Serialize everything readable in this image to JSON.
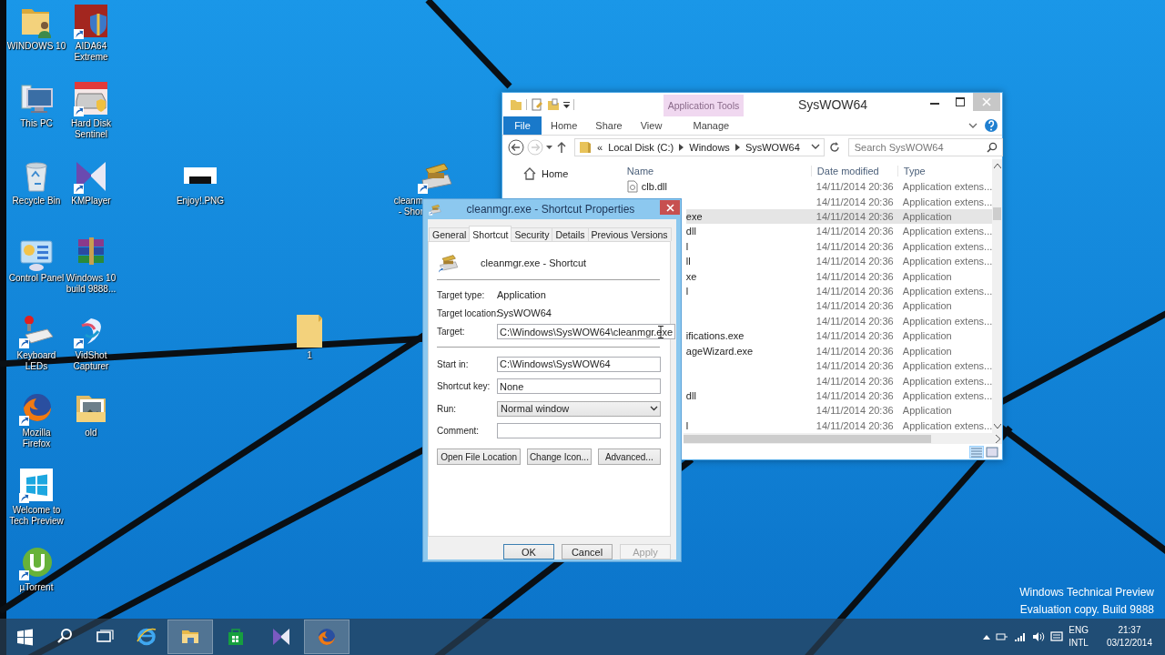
{
  "desktop": {
    "icons": [
      {
        "label": "WINDOWS 10"
      },
      {
        "label": "This PC"
      },
      {
        "label": "Recycle Bin"
      },
      {
        "label": "Control Panel"
      },
      {
        "label": "Keyboard\nLEDs"
      },
      {
        "label": "Mozilla\nFirefox"
      },
      {
        "label": "Welcome to\nTech Preview"
      },
      {
        "label": "µTorrent"
      },
      {
        "label": "AIDA64\nExtreme"
      },
      {
        "label": "Hard Disk\nSentinel"
      },
      {
        "label": "KMPlayer"
      },
      {
        "label": "Windows 10\nbuild 9888..."
      },
      {
        "label": "VidShot\nCapturer"
      },
      {
        "label": "old"
      },
      {
        "label": "Enjoy!.PNG"
      },
      {
        "label": "1"
      },
      {
        "label": "cleanm\n- Shor"
      }
    ],
    "edition": [
      "Windows Technical Preview",
      "Evaluation copy. Build 9888"
    ]
  },
  "explorer": {
    "title": "SysWOW64",
    "context_header": "Application Tools",
    "ribbon_tabs": [
      {
        "label": "File",
        "kind": "file"
      },
      {
        "label": "Home",
        "kind": "tab"
      },
      {
        "label": "Share",
        "kind": "tab"
      },
      {
        "label": "View",
        "kind": "tab"
      },
      {
        "label": "Manage",
        "kind": "context"
      }
    ],
    "address": {
      "overflow": "«",
      "crumbs": [
        "Local Disk (C:)",
        "Windows",
        "SysWOW64"
      ]
    },
    "search": {
      "placeholder": "Search SysWOW64"
    },
    "nav": [
      {
        "label": "Home"
      }
    ],
    "columns": [
      "Name",
      "Date modified",
      "Type"
    ],
    "rows": [
      {
        "name": "clb.dll",
        "date": "14/11/2014 20:36",
        "type": "Application extens...",
        "selected": false
      },
      {
        "date": "14/11/2014 20:36",
        "type": "Application extens...",
        "selected": false
      },
      {
        "name": "exe",
        "date": "14/11/2014 20:36",
        "type": "Application",
        "selected": true
      },
      {
        "name": "dll",
        "date": "14/11/2014 20:36",
        "type": "Application extens...",
        "selected": false
      },
      {
        "name": "l",
        "date": "14/11/2014 20:36",
        "type": "Application extens...",
        "selected": false
      },
      {
        "name": "ll",
        "date": "14/11/2014 20:36",
        "type": "Application extens...",
        "selected": false
      },
      {
        "name": "xe",
        "date": "14/11/2014 20:36",
        "type": "Application",
        "selected": false
      },
      {
        "name": "l",
        "date": "14/11/2014 20:36",
        "type": "Application extens...",
        "selected": false
      },
      {
        "date": "14/11/2014 20:36",
        "type": "Application",
        "selected": false
      },
      {
        "date": "14/11/2014 20:36",
        "type": "Application extens...",
        "selected": false
      },
      {
        "name": "ifications.exe",
        "date": "14/11/2014 20:36",
        "type": "Application",
        "selected": false
      },
      {
        "name": "ageWizard.exe",
        "date": "14/11/2014 20:36",
        "type": "Application",
        "selected": false
      },
      {
        "date": "14/11/2014 20:36",
        "type": "Application extens...",
        "selected": false
      },
      {
        "date": "14/11/2014 20:36",
        "type": "Application extens...",
        "selected": false
      },
      {
        "name": "dll",
        "date": "14/11/2014 20:36",
        "type": "Application extens...",
        "selected": false
      },
      {
        "date": "14/11/2014 20:36",
        "type": "Application",
        "selected": false
      },
      {
        "name": "l",
        "date": "14/11/2014 20:36",
        "type": "Application extens...",
        "selected": false
      }
    ]
  },
  "dialog": {
    "title": "cleanmgr.exe - Shortcut Properties",
    "tabs": [
      {
        "label": "General",
        "selected": false
      },
      {
        "label": "Shortcut",
        "selected": true
      },
      {
        "label": "Security",
        "selected": false
      },
      {
        "label": "Details",
        "selected": false
      },
      {
        "label": "Previous Versions",
        "selected": false
      }
    ],
    "shortcut_name": "cleanmgr.exe - Shortcut",
    "info": [
      {
        "label": "Target type:",
        "kind": "text",
        "value": "Application"
      },
      {
        "label": "Target location:",
        "kind": "text",
        "value": "SysWOW64"
      },
      {
        "label": "Target:",
        "kind": "input",
        "value": "C:\\Windows\\SysWOW64\\cleanmgr.exe"
      }
    ],
    "fields": [
      {
        "label": "Start in:",
        "kind": "input",
        "value": "C:\\Windows\\SysWOW64"
      },
      {
        "label": "Shortcut key:",
        "kind": "input",
        "value": "None"
      },
      {
        "label": "Run:",
        "kind": "select",
        "value": "Normal window"
      },
      {
        "label": "Comment:",
        "kind": "input"
      }
    ],
    "buttons": [
      {
        "label": "Open File Location"
      },
      {
        "label": "Change Icon..."
      },
      {
        "label": "Advanced..."
      }
    ],
    "footer_buttons": [
      {
        "label": "OK",
        "kind": "default",
        "disabled": false
      },
      {
        "label": "Cancel",
        "kind": "normal",
        "disabled": false
      },
      {
        "label": "Apply",
        "kind": "normal",
        "disabled": true
      }
    ]
  },
  "taskbar": {
    "items": [
      {
        "active": false
      },
      {
        "active": false
      },
      {
        "active": false
      },
      {
        "active": false
      },
      {
        "active": true
      },
      {
        "active": false
      },
      {
        "active": false
      },
      {
        "active": true
      }
    ],
    "language": "ENG",
    "layout": "INTL",
    "time": "21:37",
    "date": "03/12/2014"
  }
}
